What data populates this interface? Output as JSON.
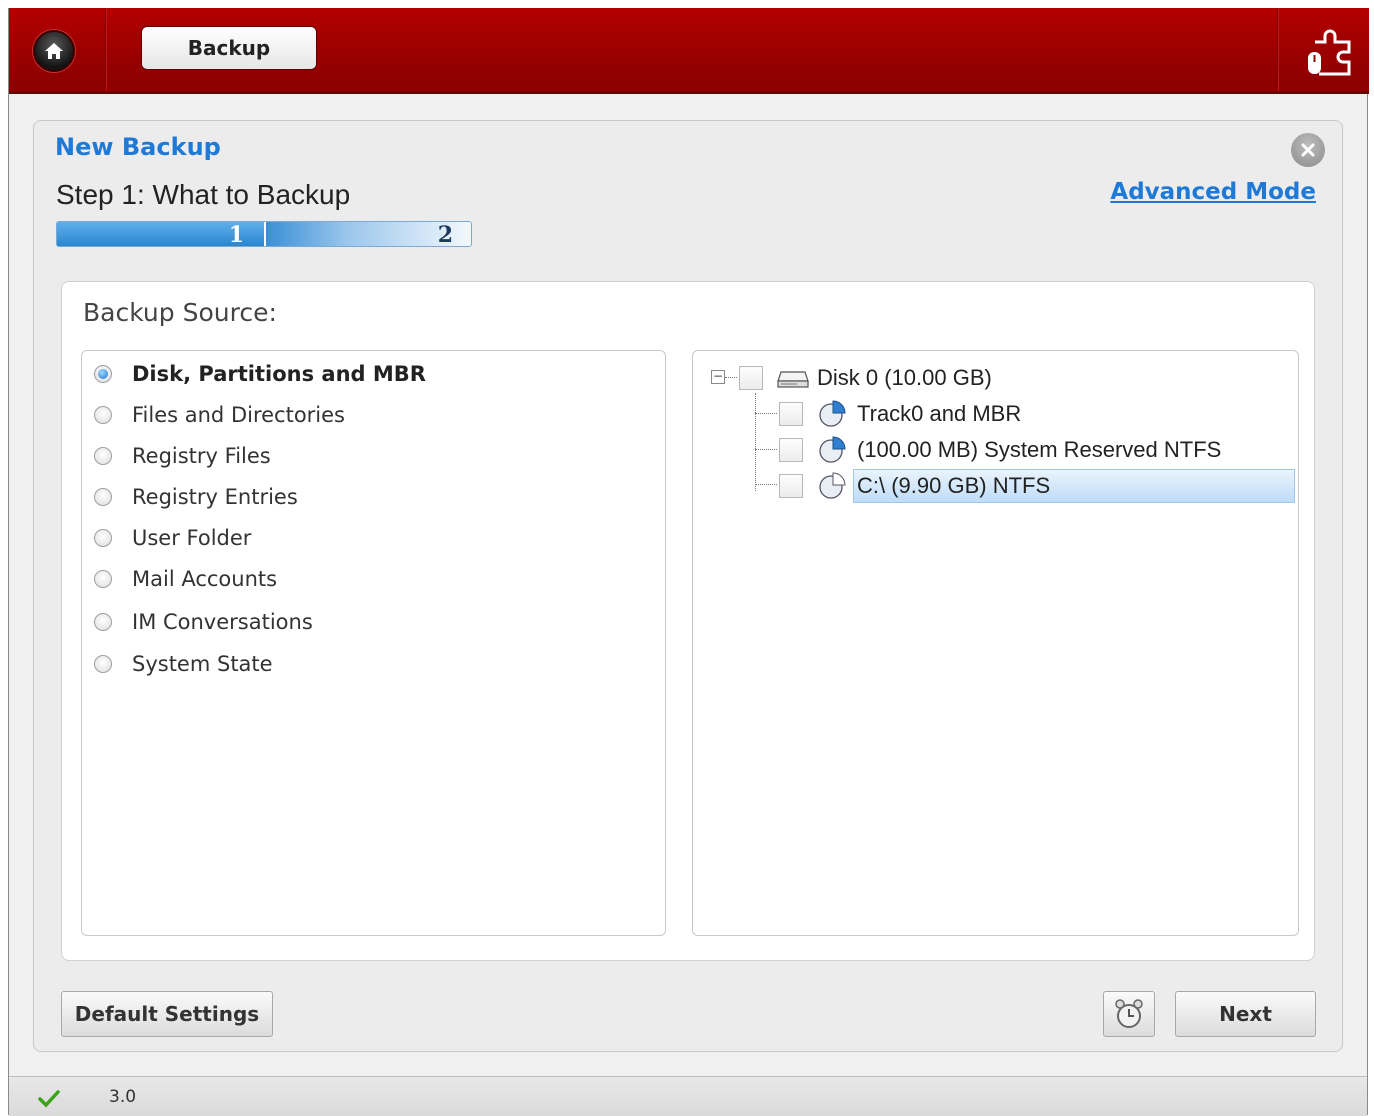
{
  "topbar": {
    "home_icon": "home-icon",
    "tab_label": "Backup",
    "tools_icon": "puzzle-icon"
  },
  "wizard": {
    "title": "New Backup",
    "step_title": "Step 1: What to Backup",
    "advanced_link": "Advanced Mode",
    "progress": {
      "current_step": 1,
      "total_steps": 2,
      "step1_label": "1",
      "step2_label": "2"
    }
  },
  "source": {
    "label": "Backup Source:",
    "options": [
      {
        "label": "Disk, Partitions and MBR",
        "selected": true
      },
      {
        "label": "Files and Directories",
        "selected": false
      },
      {
        "label": "Registry Files",
        "selected": false
      },
      {
        "label": "Registry Entries",
        "selected": false
      },
      {
        "label": "User Folder",
        "selected": false
      },
      {
        "label": "Mail Accounts",
        "selected": false
      },
      {
        "label": "IM Conversations",
        "selected": false
      },
      {
        "label": "System State",
        "selected": false
      }
    ]
  },
  "tree": {
    "disk": "Disk 0 (10.00 GB)",
    "items": [
      {
        "label": "Track0 and MBR",
        "checked": false
      },
      {
        "label": "(100.00 MB) System Reserved NTFS",
        "checked": false
      },
      {
        "label": "C:\\ (9.90 GB) NTFS",
        "checked": false,
        "highlighted": true
      }
    ]
  },
  "buttons": {
    "default_settings": "Default Settings",
    "schedule_icon": "alarm-clock-icon",
    "next": "Next"
  },
  "status": {
    "icon": "checkmark-icon",
    "version": "3.0"
  },
  "colors": {
    "topbar": "#9a0000",
    "accent": "#1e7ad6",
    "selection": "#bfdcf7"
  }
}
